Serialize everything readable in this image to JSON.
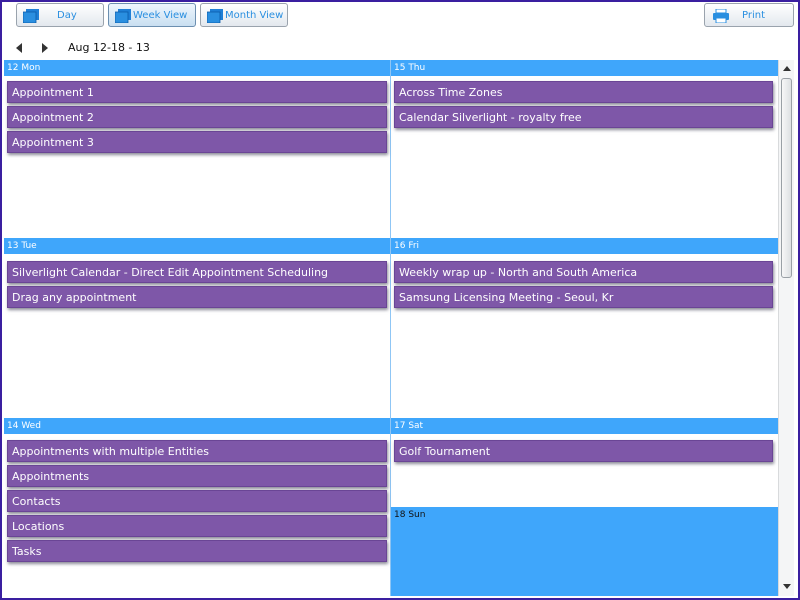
{
  "toolbar": {
    "day_label": "Day",
    "week_label": "Week View",
    "month_label": "Month View",
    "print_label": "Print"
  },
  "nav": {
    "date_range": "Aug 12-18 - 13"
  },
  "colors": {
    "header": "#3fa6fb",
    "appointment": "#7e57a8",
    "accent": "#2a8fe0"
  },
  "days": [
    {
      "label": "12 Mon",
      "appointments": [
        "Appointment 1",
        "Appointment 2",
        "Appointment 3"
      ]
    },
    {
      "label": "13 Tue",
      "appointments": [
        "Silverlight Calendar - Direct Edit Appointment Scheduling",
        "Drag any appointment"
      ]
    },
    {
      "label": "14 Wed",
      "appointments": [
        "Appointments with multiple Entities",
        "Appointments",
        "Contacts",
        "Locations",
        "Tasks"
      ]
    },
    {
      "label": "15 Thu",
      "appointments": [
        "Across Time Zones",
        "Calendar Silverlight - royalty free"
      ]
    },
    {
      "label": "16 Fri",
      "appointments": [
        "Weekly wrap up - North and South America",
        "Samsung Licensing Meeting - Seoul, Kr"
      ]
    },
    {
      "label": "17 Sat",
      "appointments": [
        "Golf Tournament"
      ]
    },
    {
      "label": "18 Sun",
      "appointments": []
    }
  ]
}
